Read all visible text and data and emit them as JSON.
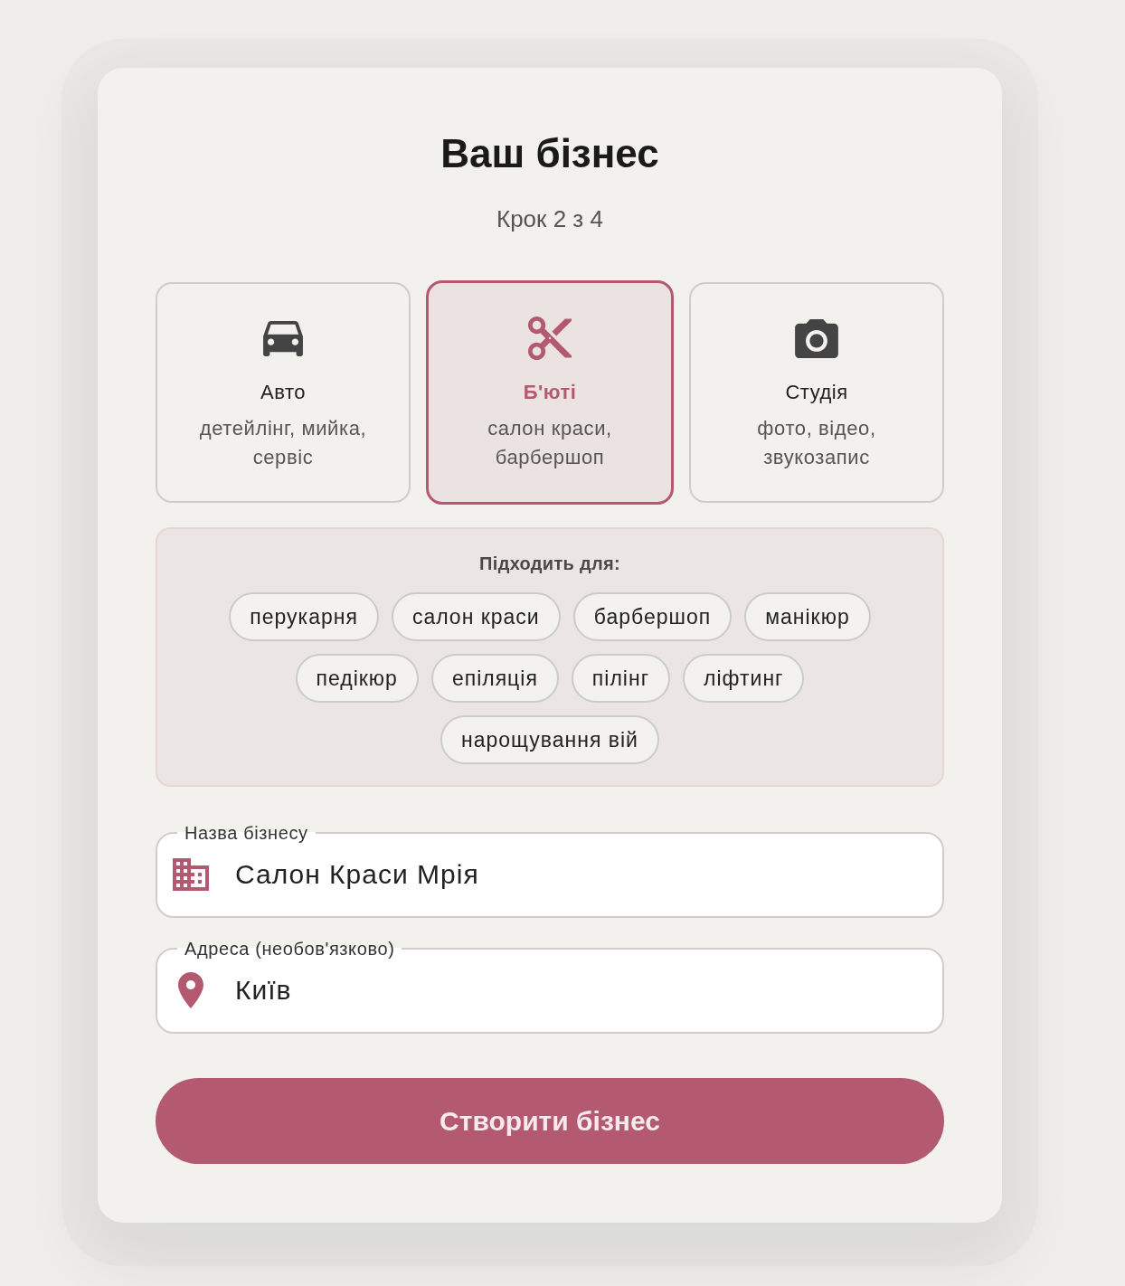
{
  "header": {
    "title": "Ваш бізнес",
    "step": "Крок 2 з 4"
  },
  "categories": [
    {
      "label": "Авто",
      "description": "детейлінг, мийка, сервіс",
      "selected": false
    },
    {
      "label": "Б'юті",
      "description": "салон краси, барбершоп",
      "selected": true
    },
    {
      "label": "Студія",
      "description": "фото, відео, звукозапис",
      "selected": false
    }
  ],
  "suitable_for": {
    "title": "Підходить для:",
    "tags": [
      "перукарня",
      "салон краси",
      "барбершоп",
      "манікюр",
      "педікюр",
      "епіляція",
      "пілінг",
      "ліфтинг",
      "нарощування вій"
    ]
  },
  "fields": [
    {
      "label": "Назва бізнесу",
      "value": "Салон Краси Мрія"
    },
    {
      "label": "Адреса (необов'язково)",
      "value": "Київ"
    }
  ],
  "submit_button": {
    "label": "Створити бізнес"
  }
}
